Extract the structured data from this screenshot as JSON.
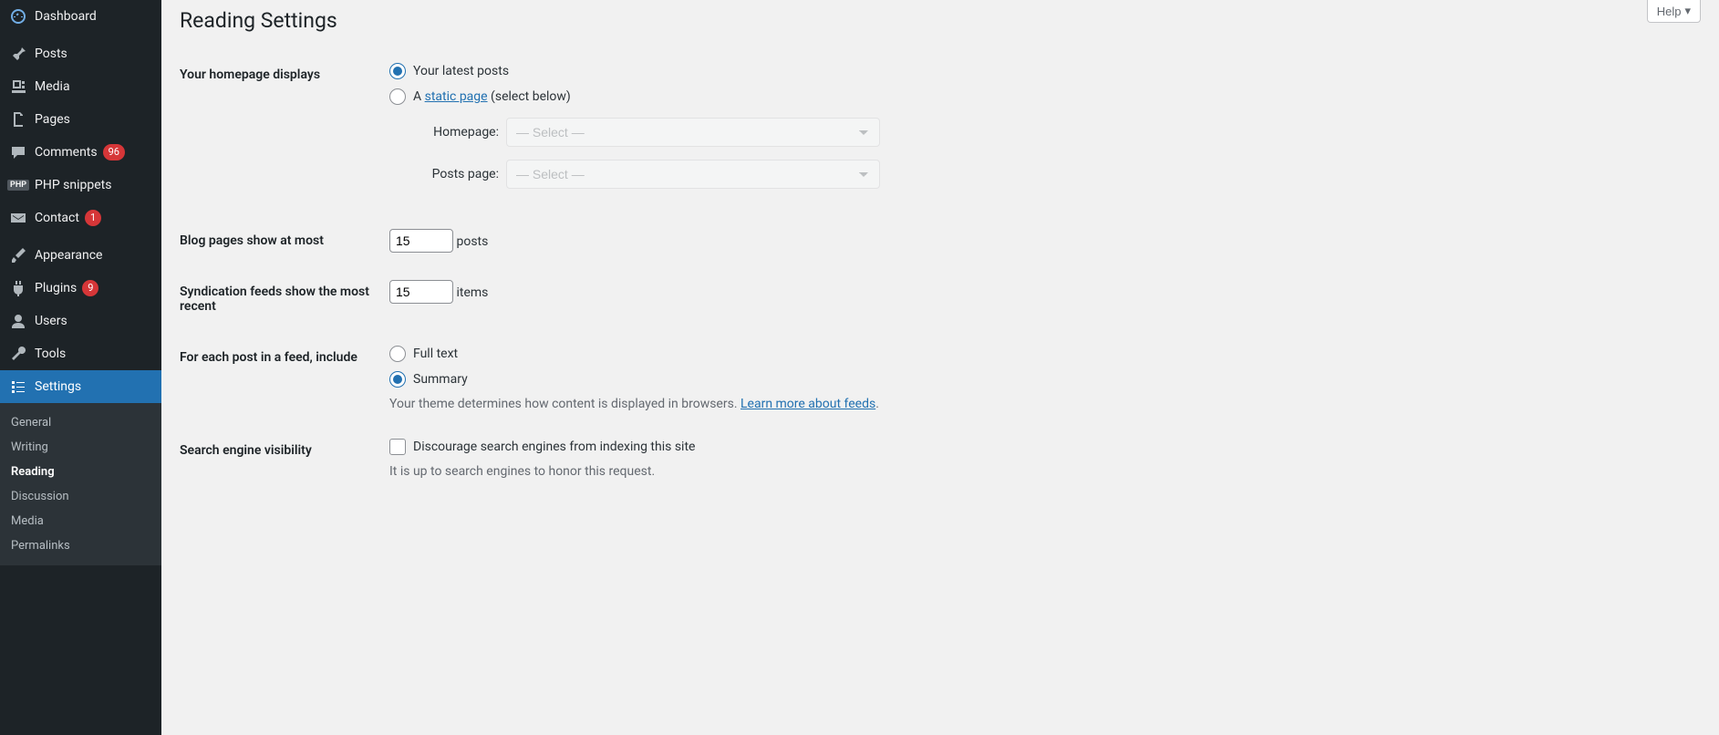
{
  "help_label": "Help",
  "page_title": "Reading Settings",
  "sidebar": {
    "items": [
      {
        "icon": "dashboard",
        "label": "Dashboard"
      },
      {
        "icon": "pin",
        "label": "Posts"
      },
      {
        "icon": "media",
        "label": "Media"
      },
      {
        "icon": "page",
        "label": "Pages"
      },
      {
        "icon": "comment",
        "label": "Comments",
        "badge": "96"
      },
      {
        "icon": "php",
        "label": "PHP snippets"
      },
      {
        "icon": "mail",
        "label": "Contact",
        "badge": "1"
      },
      {
        "icon": "brush",
        "label": "Appearance"
      },
      {
        "icon": "plugin",
        "label": "Plugins",
        "badge": "9"
      },
      {
        "icon": "user",
        "label": "Users"
      },
      {
        "icon": "wrench",
        "label": "Tools"
      },
      {
        "icon": "settings",
        "label": "Settings"
      }
    ],
    "submenu": [
      "General",
      "Writing",
      "Reading",
      "Discussion",
      "Media",
      "Permalinks"
    ]
  },
  "form": {
    "homepage": {
      "heading": "Your homepage displays",
      "opt_latest": "Your latest posts",
      "opt_static_prefix": "A ",
      "opt_static_link": "static page",
      "opt_static_suffix": " (select below)",
      "homepage_label": "Homepage:",
      "postspage_label": "Posts page:",
      "select_placeholder": "— Select —"
    },
    "posts_per_page": {
      "heading": "Blog pages show at most",
      "value": "15",
      "suffix": "posts"
    },
    "syndication": {
      "heading": "Syndication feeds show the most recent",
      "value": "15",
      "suffix": "items"
    },
    "feed_content": {
      "heading": "For each post in a feed, include",
      "opt_full": "Full text",
      "opt_summary": "Summary",
      "desc_prefix": "Your theme determines how content is displayed in browsers. ",
      "desc_link": "Learn more about feeds",
      "desc_suffix": "."
    },
    "search": {
      "heading": "Search engine visibility",
      "checkbox_label": "Discourage search engines from indexing this site",
      "note": "It is up to search engines to honor this request."
    }
  }
}
